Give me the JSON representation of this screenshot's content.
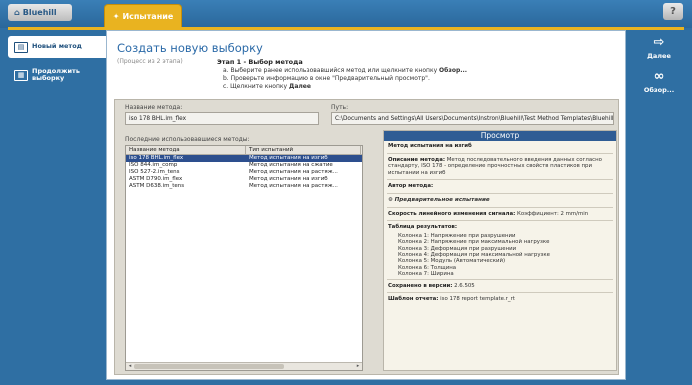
{
  "tabs": {
    "home_label": "Bluehill",
    "active_label": "Испытание",
    "help_label": "?"
  },
  "sidebar": {
    "items": [
      {
        "label": "Новый метод"
      },
      {
        "label": "Продолжить выборку"
      }
    ]
  },
  "header": {
    "title": "Создать новую выборку",
    "process": "(Процесс из 2 этапа)",
    "step_title": "Этап 1 - Выбор метода",
    "line_a": "a. Выберите ранее использовавшийся метод или щелкните кнопку ",
    "line_a_bold": "Обзор...",
    "line_b": "b. Проверьте информацию в окне \"Предварительный просмотр\".",
    "line_c": "c. Щелкните кнопку ",
    "line_c_bold": "Далее"
  },
  "method_name": {
    "label": "Название метода:",
    "value": "iso 178 BHL.im_flex"
  },
  "path": {
    "label": "Путь:",
    "value": "C:\\Documents and Settings\\All Users\\Documents\\Instron\\Bluehill\\Test Method Templates\\Bluehill"
  },
  "recent": {
    "label": "Последние использовавшиеся методы:",
    "columns": [
      "Название метода",
      "Тип испытаний"
    ],
    "rows": [
      {
        "name": "iso 178 BHL.im_flex",
        "type": "Метод испытания на изгиб"
      },
      {
        "name": "ISO 844.im_comp",
        "type": "Метод испытания на сжатие"
      },
      {
        "name": "ISO 527-2.im_tens",
        "type": "Метод испытания на растяж..."
      },
      {
        "name": "ASTM D790.im_flex",
        "type": "Метод испытания на изгиб"
      },
      {
        "name": "ASTM D638.im_tens",
        "type": "Метод испытания на растяж..."
      }
    ],
    "scroll_left": "◂",
    "scroll_right": "▸"
  },
  "preview": {
    "title": "Просмотр",
    "method_type": "Метод испытания на изгиб",
    "desc_label": "Описание метода:",
    "desc_text": " Метод последовательного введения данных согласно стандарту, ISO 178 - определение прочностных свойств пластиков при испытании на изгиб",
    "author_label": "Автор метода:",
    "prestest": "Предварительное испытание",
    "speed_label": "Скорость линейного изменения сигнала:",
    "speed_value": " Коэффициент: 2 mm/min",
    "results_label": "Таблица результатов:",
    "results": [
      "Колонка 1: Напряжение при разрушении",
      "Колонка 2: Напряжение при максимальной нагрузке",
      "Колонка 3: Деформация при разрушении",
      "Колонка 4: Деформация при максимальной нагрузке",
      "Колонка 5: Модуль (Автоматический)",
      "Колонка 6: Толщина",
      "Колонка 7: Ширина"
    ],
    "version_label": "Сохранено в версии:",
    "version_value": " 2.6.505",
    "report_label": "Шаблон отчета:",
    "report_value": " iso 178 report template.r_rt"
  },
  "right": {
    "next_label": "Далее",
    "browse_label": "Обзор..."
  },
  "colors": {
    "background": "#2f6fa3",
    "accent": "#e9b320",
    "selection": "#2d4f8e",
    "preview_header": "#2f5c94"
  }
}
